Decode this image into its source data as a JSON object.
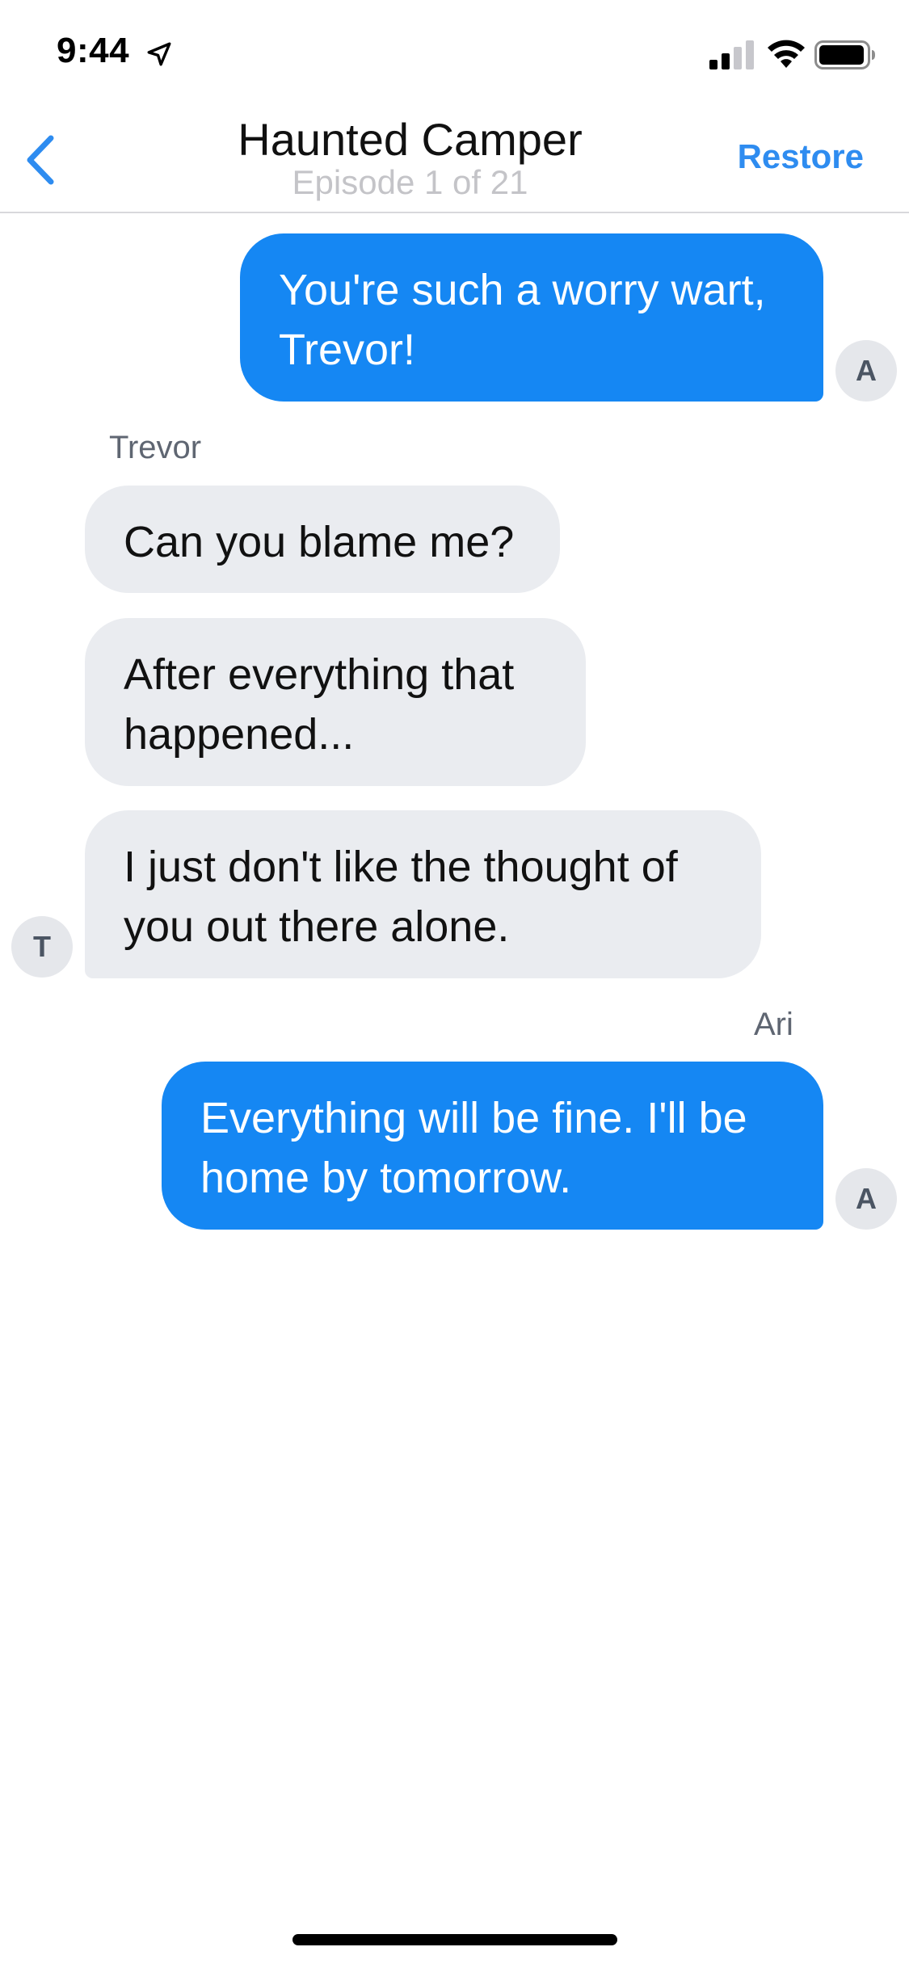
{
  "status_bar": {
    "time": "9:44",
    "icons": [
      "location-arrow-icon",
      "cellular-signal-icon",
      "wifi-icon",
      "battery-icon"
    ]
  },
  "nav": {
    "back_icon": "chevron-left-icon",
    "title": "Haunted Camper",
    "subtitle": "Episode 1 of 21",
    "restore_label": "Restore"
  },
  "messages": [
    {
      "direction": "out",
      "sender": "A",
      "lines": [
        "You're such a worry wart,",
        "Trevor!"
      ]
    },
    {
      "direction": "in",
      "sender_name": "Trevor",
      "lines": [
        "Can you blame me?"
      ]
    },
    {
      "direction": "in",
      "lines": [
        "After everything that",
        "happened..."
      ]
    },
    {
      "direction": "in",
      "sender": "T",
      "lines": [
        "I just don't like the thought of",
        "you out there alone."
      ]
    },
    {
      "direction": "out",
      "sender_name": "Ari",
      "sender": "A",
      "lines": [
        "Everything will be fine. I'll be",
        "home by tomorrow."
      ]
    }
  ],
  "colors": {
    "accent": "#2e8cf0",
    "outgoing_bubble": "#1587f3",
    "incoming_bubble": "#eaecf0",
    "avatar_bg": "#e5e7eb"
  }
}
